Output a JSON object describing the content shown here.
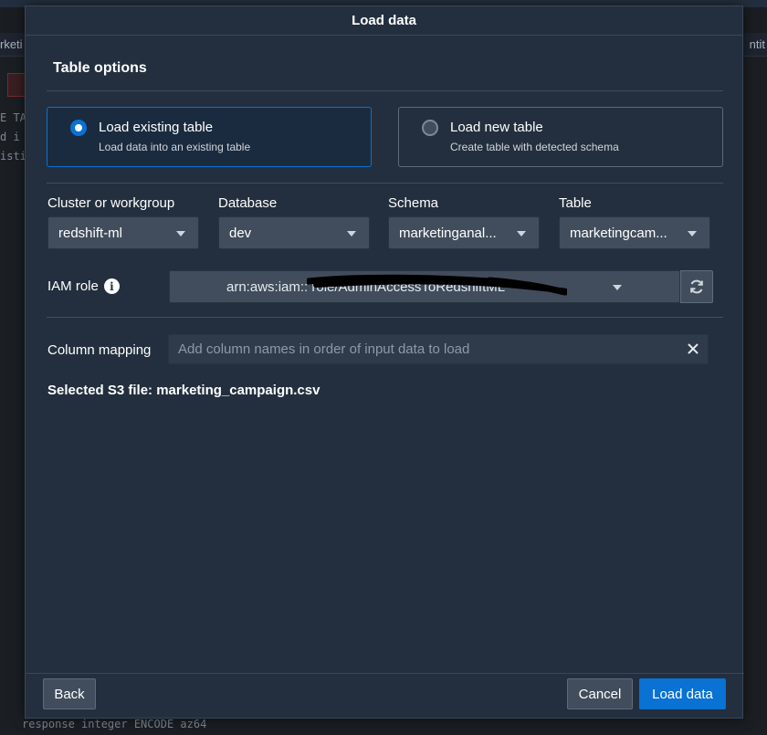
{
  "background": {
    "tab_left": "rketi",
    "tab_right": "ntit",
    "code_lines": [
      "E TA",
      "d i",
      "isti"
    ],
    "code_bottom": "response integer ENCODE az64"
  },
  "modal": {
    "title": "Load data",
    "section_title": "Table options",
    "options": [
      {
        "label": "Load existing table",
        "description": "Load data into an existing table",
        "selected": true
      },
      {
        "label": "Load new table",
        "description": "Create table with detected schema",
        "selected": false
      }
    ],
    "fields": {
      "cluster": {
        "label": "Cluster or workgroup",
        "value": "redshift-ml"
      },
      "database": {
        "label": "Database",
        "value": "dev"
      },
      "schema": {
        "label": "Schema",
        "value": "marketinganal..."
      },
      "table": {
        "label": "Table",
        "value": "marketingcam..."
      }
    },
    "iam": {
      "label": "IAM role",
      "value": "arn:aws:iam::            role/AdminAccessToRedshiftML",
      "info_icon": "info-icon",
      "refresh_icon": "refresh-icon"
    },
    "column_mapping": {
      "label": "Column mapping",
      "placeholder": "Add column names in order of input data to load",
      "value": ""
    },
    "selected_file": "Selected S3 file: marketing_campaign.csv",
    "buttons": {
      "back": "Back",
      "cancel": "Cancel",
      "load": "Load data"
    }
  },
  "colors": {
    "modal_bg": "#232f3e",
    "accent": "#0972d3",
    "field_bg": "#414d5c"
  }
}
